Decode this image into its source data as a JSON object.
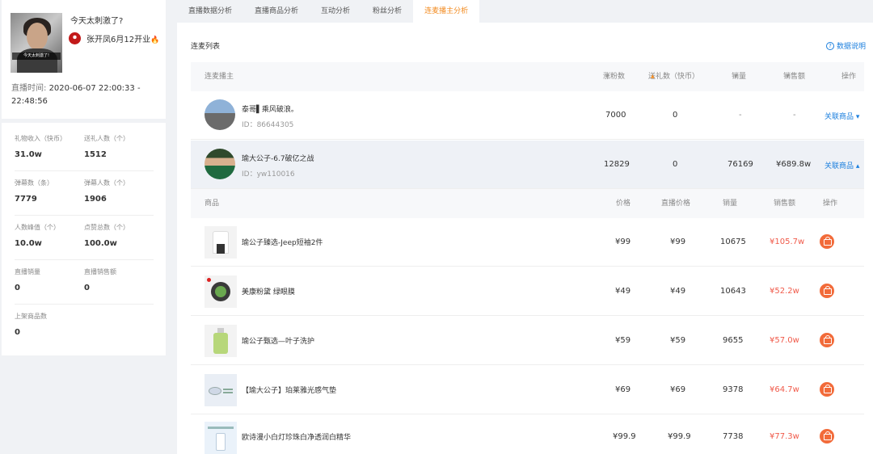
{
  "live": {
    "title": "今天太刺激了?",
    "thumb_caption": "今天太刺激了!",
    "host_name": "张开凤6月12开业",
    "time_label": "直播时间:",
    "time_value": "2020-06-07 22:00:33 - 22:48:56"
  },
  "stats": [
    {
      "label": "礼物收入（快币）",
      "value": "31.0w"
    },
    {
      "label": "送礼人数（个）",
      "value": "1512"
    },
    {
      "label": "弹幕数（条）",
      "value": "7779"
    },
    {
      "label": "弹幕人数（个）",
      "value": "1906"
    },
    {
      "label": "人数峰值（个）",
      "value": "10.0w"
    },
    {
      "label": "点赞总数（个）",
      "value": "100.0w"
    },
    {
      "label": "直播销量",
      "value": "0"
    },
    {
      "label": "直播销售额",
      "value": "0"
    },
    {
      "label": "上架商品数",
      "value": "0"
    }
  ],
  "tabs": [
    "直播数据分析",
    "直播商品分析",
    "互动分析",
    "粉丝分析",
    "连麦播主分析"
  ],
  "active_tab": "连麦播主分析",
  "list_title": "连麦列表",
  "data_note": "数据说明",
  "anchor_headers": {
    "anchor": "连麦播主",
    "fans_gain": "涨粉数",
    "gift_sent": "送礼数（快币）",
    "sales": "销量",
    "revenue": "销售额",
    "op": "操作"
  },
  "anchors": [
    {
      "name": "泰哥▌乘风破浪。",
      "id": "ID：86644305",
      "fans_gain": "7000",
      "gift": "0",
      "sales": "-",
      "revenue": "-",
      "action": "关联商品",
      "expanded": false
    },
    {
      "name": "瑜大公子-6.7破亿之战",
      "id": "ID：yw110016",
      "fans_gain": "12829",
      "gift": "0",
      "sales": "76169",
      "revenue": "¥689.8w",
      "action": "关联商品",
      "expanded": true
    }
  ],
  "product_headers": {
    "product": "商品",
    "price": "价格",
    "live_price": "直播价格",
    "sales": "销量",
    "revenue": "销售额",
    "op": "操作"
  },
  "products": [
    {
      "name": "瑜公子臻选-Jeep短袖2件",
      "price": "¥99",
      "live_price": "¥99",
      "sales": "10675",
      "revenue": "¥105.7w"
    },
    {
      "name": "美康粉黛  绿眼膜",
      "price": "¥49",
      "live_price": "¥49",
      "sales": "10643",
      "revenue": "¥52.2w"
    },
    {
      "name": "瑜公子甄选—叶子洗护",
      "price": "¥59",
      "live_price": "¥59",
      "sales": "9655",
      "revenue": "¥57.0w"
    },
    {
      "name": "【瑜大公子】珀莱雅光感气垫",
      "price": "¥69",
      "live_price": "¥69",
      "sales": "9378",
      "revenue": "¥64.7w"
    },
    {
      "name": "欧诗漫小白灯珍珠白净透润白精华",
      "price": "¥99.9",
      "live_price": "¥99.9",
      "sales": "7738",
      "revenue": "¥77.3w"
    }
  ],
  "colors": {
    "accent": "#f28b20",
    "link": "#1b7fde",
    "revenue_red": "#f05a4a",
    "op_button": "#f26b3a"
  }
}
